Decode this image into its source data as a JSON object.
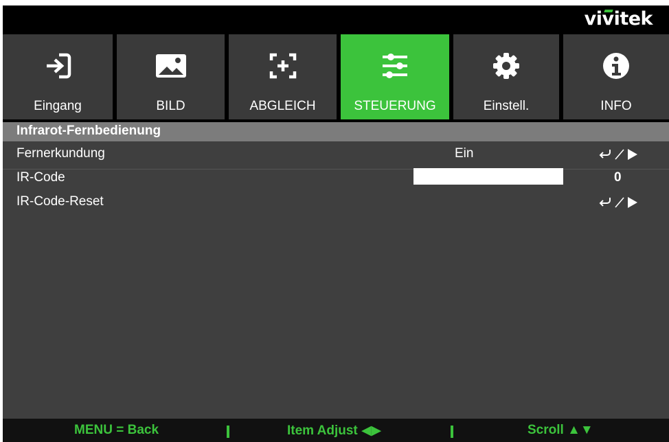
{
  "brand": {
    "name": "vivitek",
    "accent_color": "#3cc33c"
  },
  "tabs": [
    {
      "label": "Eingang",
      "icon": "input-arrow-icon",
      "active": false
    },
    {
      "label": "BILD",
      "icon": "picture-icon",
      "active": false
    },
    {
      "label": "ABGLEICH",
      "icon": "alignment-plus-icon",
      "active": false
    },
    {
      "label": "STEUERUNG",
      "icon": "sliders-icon",
      "active": true
    },
    {
      "label": "Einstell.",
      "icon": "gear-icon",
      "active": false
    },
    {
      "label": "INFO",
      "icon": "info-icon",
      "active": false
    }
  ],
  "section": {
    "title": "Infrarot-Fernbedienung"
  },
  "rows": [
    {
      "label": "Fernerkundung",
      "value": "Ein",
      "action": "enter-right-arrow"
    },
    {
      "label": "IR-Code",
      "value": "0"
    },
    {
      "label": "IR-Code-Reset",
      "action": "enter-right-arrow"
    }
  ],
  "footer": {
    "menu_back": "MENU = Back",
    "item_adjust": "Item Adjust ◀▶",
    "scroll": "Scroll ▲▼"
  },
  "colors": {
    "background": "#3f3f3f",
    "active_tab": "#3cc33c",
    "header": "#7c7c7c",
    "hint_text": "#3cc33c"
  }
}
